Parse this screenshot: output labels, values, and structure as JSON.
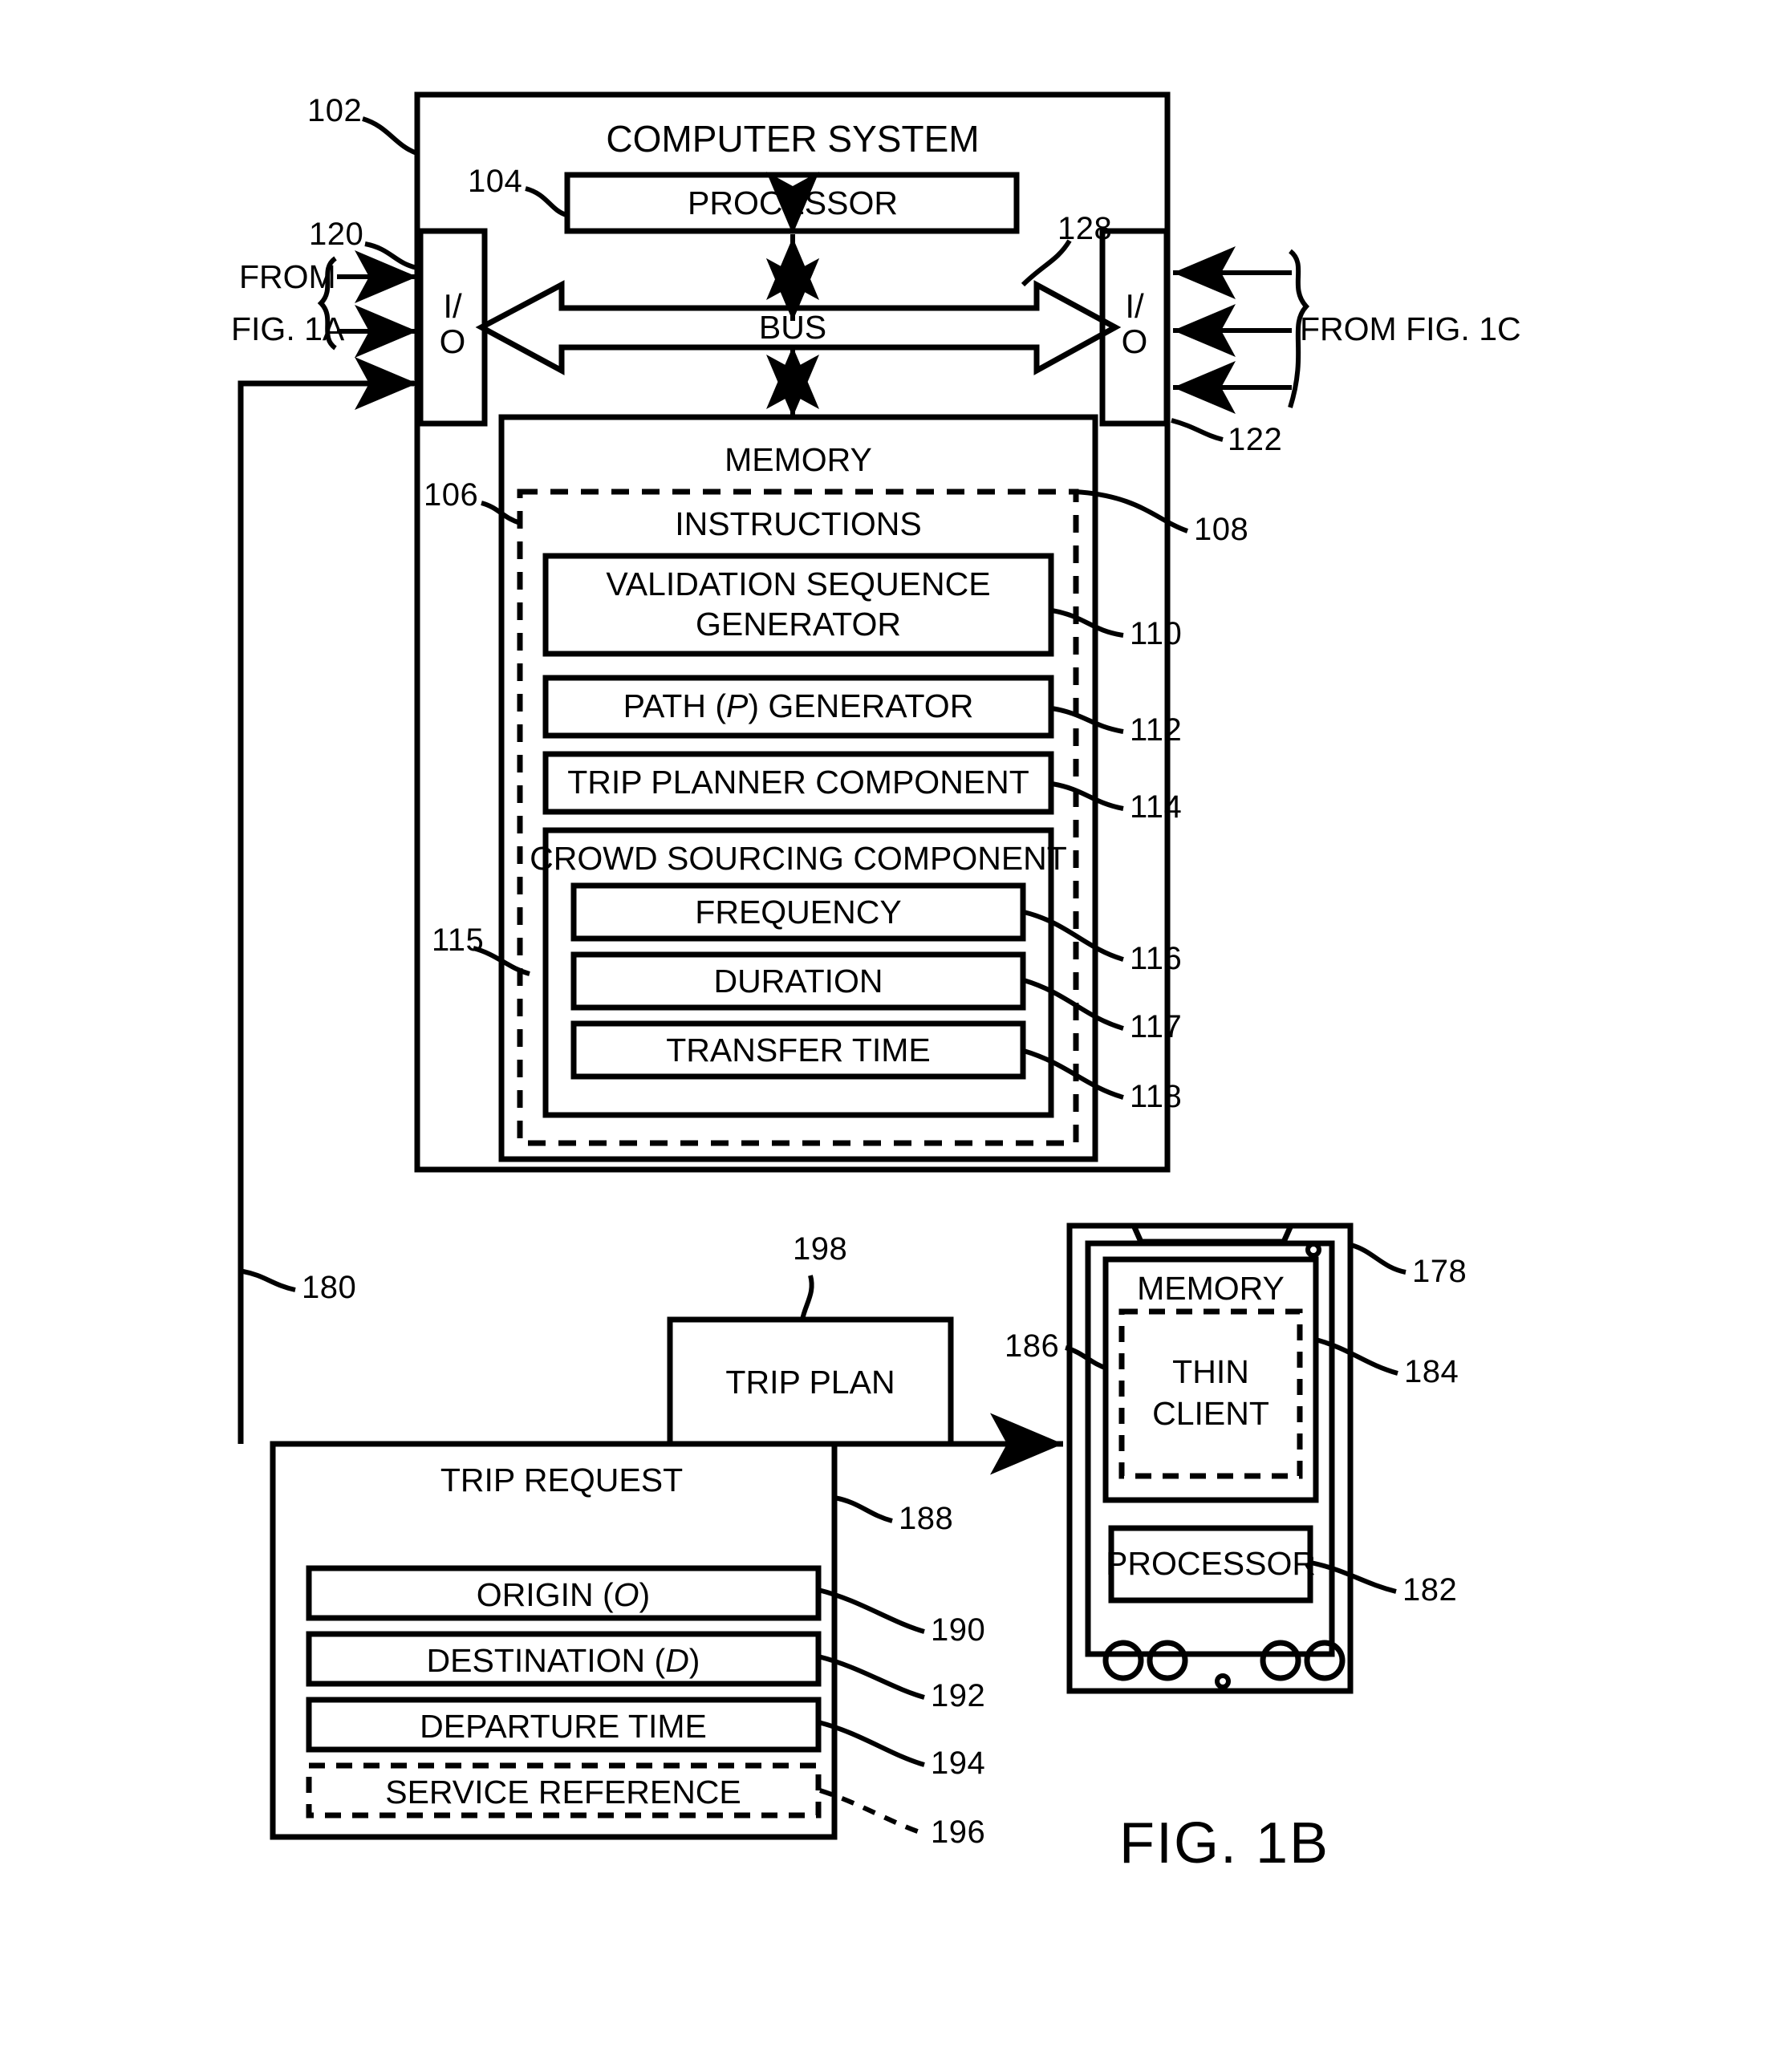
{
  "figure": {
    "label": "FIG. 1B"
  },
  "computer_system": {
    "title": "COMPUTER SYSTEM",
    "ref": "102",
    "processor": {
      "label": "PROCESSOR",
      "ref": "104"
    },
    "bus": {
      "label": "BUS"
    },
    "io_left": {
      "line1": "I/",
      "line2": "O",
      "ref": "120"
    },
    "io_right": {
      "line1": "I/",
      "line2": "O",
      "ref": "122",
      "bus_arrow_ref": "128"
    },
    "from_fig_1a": {
      "line1": "FROM",
      "line2": "FIG. 1A"
    },
    "from_fig_1c": {
      "label": "FROM FIG. 1C"
    },
    "memory": {
      "title": "MEMORY",
      "ref": "106",
      "instructions": {
        "title": "INSTRUCTIONS",
        "ref": "108",
        "items": [
          {
            "label": "VALIDATION SEQUENCE\nGENERATOR",
            "line1": "VALIDATION SEQUENCE",
            "line2": "GENERATOR",
            "ref": "110"
          },
          {
            "label": "PATH (P) GENERATOR",
            "pre": "PATH (",
            "italic": "P",
            "post": ") GENERATOR",
            "ref": "112"
          },
          {
            "label": "TRIP PLANNER COMPONENT",
            "ref": "114"
          }
        ],
        "crowd_sourcing": {
          "title": "CROWD SOURCING COMPONENT",
          "ref": "115",
          "items": [
            {
              "label": "FREQUENCY",
              "ref": "116"
            },
            {
              "label": "DURATION",
              "ref": "117"
            },
            {
              "label": "TRANSFER TIME",
              "ref": "118"
            }
          ]
        }
      }
    }
  },
  "connector_180": {
    "ref": "180"
  },
  "trip_plan": {
    "label": "TRIP PLAN",
    "ref": "198"
  },
  "trip_request": {
    "title": "TRIP REQUEST",
    "ref": "188",
    "fields": [
      {
        "label": "ORIGIN (O)",
        "pre": "ORIGIN (",
        "italic": "O",
        "post": ")",
        "ref": "190",
        "dashed": false
      },
      {
        "label": "DESTINATION (D)",
        "pre": "DESTINATION (",
        "italic": "D",
        "post": ")",
        "ref": "192",
        "dashed": false
      },
      {
        "label": "DEPARTURE TIME",
        "ref": "194",
        "dashed": false
      },
      {
        "label": "SERVICE REFERENCE",
        "ref": "196",
        "dashed": true
      }
    ]
  },
  "mobile_device": {
    "ref": "178",
    "memory": {
      "title": "MEMORY",
      "ref": "186"
    },
    "thin_client": {
      "line1": "THIN",
      "line2": "CLIENT",
      "ref": "184"
    },
    "processor": {
      "label": "PROCESSOR",
      "ref": "182"
    }
  },
  "colors": {
    "ink": "#000000",
    "paper": "#ffffff"
  }
}
